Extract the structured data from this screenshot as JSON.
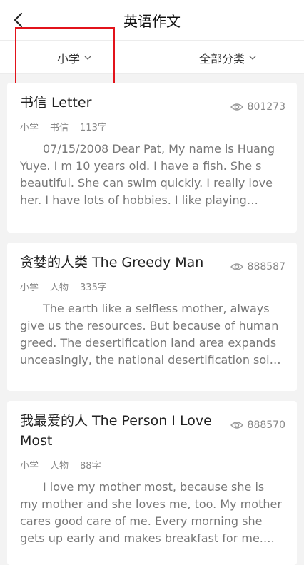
{
  "header": {
    "title": "英语作文"
  },
  "filters": {
    "level": "小学",
    "category": "全部分类"
  },
  "cards": [
    {
      "title": "书信 Letter",
      "views": "801273",
      "level": "小学",
      "category": "书信",
      "words": "113字",
      "excerpt": "07/15/2008  Dear Pat,  My name is Huang Yuye. I m 10 years old. I have a fish. She s beautiful. She can swim quickly. I really love her. I have lots of hobbies. I like playing chess…"
    },
    {
      "title": "贪婪的人类  The Greedy Man",
      "views": "888587",
      "level": "小学",
      "category": "人物",
      "words": "335字",
      "excerpt": "The earth like a selfless mother, always give us the resources. But because of human greed. The desertification land area expands unceasingly, the national desertification soil a…"
    },
    {
      "title": "我最爱的人 The Person I Love Most",
      "views": "888570",
      "level": "小学",
      "category": "人物",
      "words": "88字",
      "excerpt": "I love my mother most, because she is my mother and she loves me, too. My mother cares good care of me. Every morning she gets up early and makes breakfast for me. Ev…"
    }
  ]
}
